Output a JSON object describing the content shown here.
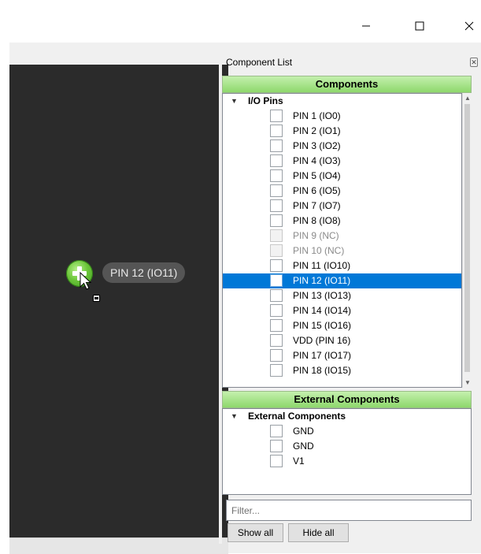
{
  "window": {
    "minimize_glyph": "—",
    "maximize_glyph": "☐",
    "close_glyph": "✕"
  },
  "canvas": {
    "node_label": "PIN 12 (IO11)",
    "node_icon": "add-icon",
    "cursor_icon": "arrow-cursor-icon"
  },
  "panel": {
    "title": "Component List",
    "close_glyph": "✕"
  },
  "components": {
    "header": "Components",
    "group": "I/O Pins",
    "items": [
      {
        "label": "PIN 1 (IO0)",
        "disabled": false,
        "selected": false
      },
      {
        "label": "PIN 2 (IO1)",
        "disabled": false,
        "selected": false
      },
      {
        "label": "PIN 3 (IO2)",
        "disabled": false,
        "selected": false
      },
      {
        "label": "PIN 4 (IO3)",
        "disabled": false,
        "selected": false
      },
      {
        "label": "PIN 5 (IO4)",
        "disabled": false,
        "selected": false
      },
      {
        "label": "PIN 6 (IO5)",
        "disabled": false,
        "selected": false
      },
      {
        "label": "PIN 7 (IO7)",
        "disabled": false,
        "selected": false
      },
      {
        "label": "PIN 8 (IO8)",
        "disabled": false,
        "selected": false
      },
      {
        "label": "PIN 9 (NC)",
        "disabled": true,
        "selected": false
      },
      {
        "label": "PIN 10 (NC)",
        "disabled": true,
        "selected": false
      },
      {
        "label": "PIN 11 (IO10)",
        "disabled": false,
        "selected": false
      },
      {
        "label": "PIN 12 (IO11)",
        "disabled": false,
        "selected": true
      },
      {
        "label": "PIN 13 (IO13)",
        "disabled": false,
        "selected": false
      },
      {
        "label": "PIN 14 (IO14)",
        "disabled": false,
        "selected": false
      },
      {
        "label": "PIN 15 (IO16)",
        "disabled": false,
        "selected": false
      },
      {
        "label": "VDD (PIN 16)",
        "disabled": false,
        "selected": false
      },
      {
        "label": "PIN 17 (IO17)",
        "disabled": false,
        "selected": false
      },
      {
        "label": "PIN 18 (IO15)",
        "disabled": false,
        "selected": false
      }
    ]
  },
  "external": {
    "header": "External Components",
    "group": "External Components",
    "items": [
      {
        "label": "GND"
      },
      {
        "label": "GND"
      },
      {
        "label": "V1"
      }
    ]
  },
  "filter": {
    "placeholder": "Filter...",
    "value": ""
  },
  "buttons": {
    "show_all": "Show all",
    "hide_all": "Hide all"
  },
  "colors": {
    "header_green": "#8ed86c",
    "selection_blue": "#0078d7",
    "canvas_bg": "#2b2b2b"
  }
}
